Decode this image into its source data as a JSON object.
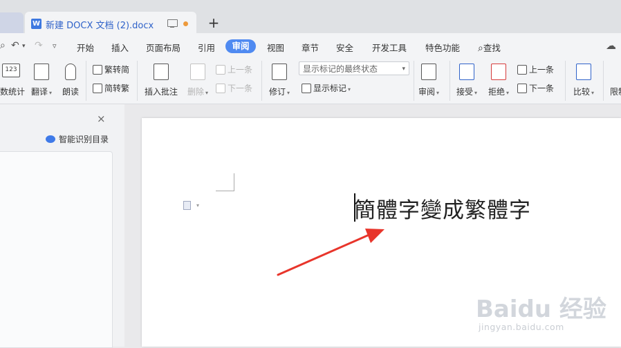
{
  "tab": {
    "title": "新建 DOCX 文档 (2).docx",
    "new_tab": "+"
  },
  "menu": {
    "items": [
      "开始",
      "插入",
      "页面布局",
      "引用",
      "视图",
      "章节",
      "安全",
      "开发工具",
      "特色功能"
    ],
    "active": "审阅",
    "search": "查找"
  },
  "ribbon": {
    "word_count": "数统计",
    "translate": "翻译",
    "read_aloud": "朗读",
    "to_traditional": "繁转简",
    "to_simplified": "简转繁",
    "insert_comment": "插入批注",
    "delete": "删除",
    "prev_comment": "上一条",
    "next_comment": "下一条",
    "revise": "修订",
    "display_markup_select": "显示标记的最终状态",
    "show_markup": "显示标记",
    "review": "审阅",
    "accept": "接受",
    "reject": "拒绝",
    "prev_change": "上一条",
    "next_change": "下一条",
    "compare": "比较",
    "restrict": "限制",
    "icon_word_count_text": "123"
  },
  "nav": {
    "close": "×",
    "smart_toc": "智能识别目录"
  },
  "document": {
    "text": "簡體字變成繁體字"
  },
  "watermark": {
    "main": "Baidu 经验",
    "sub": "jingyan.baidu.com"
  },
  "colors": {
    "accent": "#4f8af1",
    "arrow": "#e8352b",
    "tab_title": "#2f62c9"
  }
}
